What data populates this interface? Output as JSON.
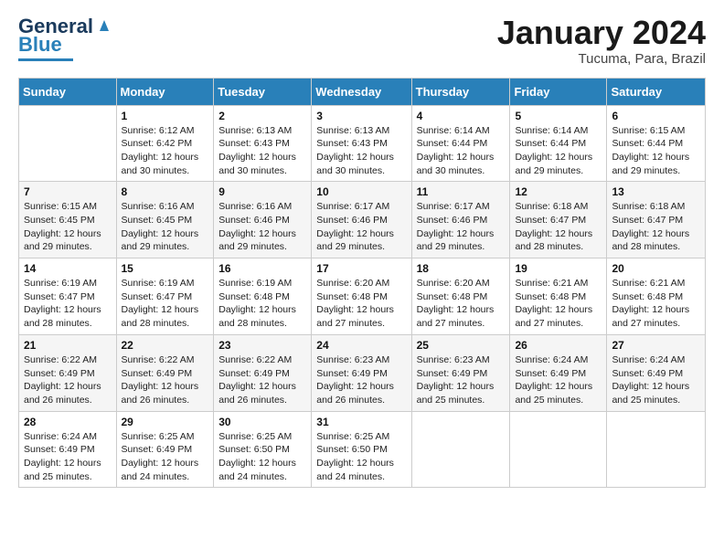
{
  "header": {
    "logo_general": "General",
    "logo_blue": "Blue",
    "month_title": "January 2024",
    "location": "Tucuma, Para, Brazil"
  },
  "days_of_week": [
    "Sunday",
    "Monday",
    "Tuesday",
    "Wednesday",
    "Thursday",
    "Friday",
    "Saturday"
  ],
  "weeks": [
    [
      {
        "day": "",
        "sunrise": "",
        "sunset": "",
        "daylight": ""
      },
      {
        "day": "1",
        "sunrise": "6:12 AM",
        "sunset": "6:42 PM",
        "daylight": "12 hours and 30 minutes."
      },
      {
        "day": "2",
        "sunrise": "6:13 AM",
        "sunset": "6:43 PM",
        "daylight": "12 hours and 30 minutes."
      },
      {
        "day": "3",
        "sunrise": "6:13 AM",
        "sunset": "6:43 PM",
        "daylight": "12 hours and 30 minutes."
      },
      {
        "day": "4",
        "sunrise": "6:14 AM",
        "sunset": "6:44 PM",
        "daylight": "12 hours and 30 minutes."
      },
      {
        "day": "5",
        "sunrise": "6:14 AM",
        "sunset": "6:44 PM",
        "daylight": "12 hours and 29 minutes."
      },
      {
        "day": "6",
        "sunrise": "6:15 AM",
        "sunset": "6:44 PM",
        "daylight": "12 hours and 29 minutes."
      }
    ],
    [
      {
        "day": "7",
        "sunrise": "6:15 AM",
        "sunset": "6:45 PM",
        "daylight": "12 hours and 29 minutes."
      },
      {
        "day": "8",
        "sunrise": "6:16 AM",
        "sunset": "6:45 PM",
        "daylight": "12 hours and 29 minutes."
      },
      {
        "day": "9",
        "sunrise": "6:16 AM",
        "sunset": "6:46 PM",
        "daylight": "12 hours and 29 minutes."
      },
      {
        "day": "10",
        "sunrise": "6:17 AM",
        "sunset": "6:46 PM",
        "daylight": "12 hours and 29 minutes."
      },
      {
        "day": "11",
        "sunrise": "6:17 AM",
        "sunset": "6:46 PM",
        "daylight": "12 hours and 29 minutes."
      },
      {
        "day": "12",
        "sunrise": "6:18 AM",
        "sunset": "6:47 PM",
        "daylight": "12 hours and 28 minutes."
      },
      {
        "day": "13",
        "sunrise": "6:18 AM",
        "sunset": "6:47 PM",
        "daylight": "12 hours and 28 minutes."
      }
    ],
    [
      {
        "day": "14",
        "sunrise": "6:19 AM",
        "sunset": "6:47 PM",
        "daylight": "12 hours and 28 minutes."
      },
      {
        "day": "15",
        "sunrise": "6:19 AM",
        "sunset": "6:47 PM",
        "daylight": "12 hours and 28 minutes."
      },
      {
        "day": "16",
        "sunrise": "6:19 AM",
        "sunset": "6:48 PM",
        "daylight": "12 hours and 28 minutes."
      },
      {
        "day": "17",
        "sunrise": "6:20 AM",
        "sunset": "6:48 PM",
        "daylight": "12 hours and 27 minutes."
      },
      {
        "day": "18",
        "sunrise": "6:20 AM",
        "sunset": "6:48 PM",
        "daylight": "12 hours and 27 minutes."
      },
      {
        "day": "19",
        "sunrise": "6:21 AM",
        "sunset": "6:48 PM",
        "daylight": "12 hours and 27 minutes."
      },
      {
        "day": "20",
        "sunrise": "6:21 AM",
        "sunset": "6:48 PM",
        "daylight": "12 hours and 27 minutes."
      }
    ],
    [
      {
        "day": "21",
        "sunrise": "6:22 AM",
        "sunset": "6:49 PM",
        "daylight": "12 hours and 26 minutes."
      },
      {
        "day": "22",
        "sunrise": "6:22 AM",
        "sunset": "6:49 PM",
        "daylight": "12 hours and 26 minutes."
      },
      {
        "day": "23",
        "sunrise": "6:22 AM",
        "sunset": "6:49 PM",
        "daylight": "12 hours and 26 minutes."
      },
      {
        "day": "24",
        "sunrise": "6:23 AM",
        "sunset": "6:49 PM",
        "daylight": "12 hours and 26 minutes."
      },
      {
        "day": "25",
        "sunrise": "6:23 AM",
        "sunset": "6:49 PM",
        "daylight": "12 hours and 25 minutes."
      },
      {
        "day": "26",
        "sunrise": "6:24 AM",
        "sunset": "6:49 PM",
        "daylight": "12 hours and 25 minutes."
      },
      {
        "day": "27",
        "sunrise": "6:24 AM",
        "sunset": "6:49 PM",
        "daylight": "12 hours and 25 minutes."
      }
    ],
    [
      {
        "day": "28",
        "sunrise": "6:24 AM",
        "sunset": "6:49 PM",
        "daylight": "12 hours and 25 minutes."
      },
      {
        "day": "29",
        "sunrise": "6:25 AM",
        "sunset": "6:49 PM",
        "daylight": "12 hours and 24 minutes."
      },
      {
        "day": "30",
        "sunrise": "6:25 AM",
        "sunset": "6:50 PM",
        "daylight": "12 hours and 24 minutes."
      },
      {
        "day": "31",
        "sunrise": "6:25 AM",
        "sunset": "6:50 PM",
        "daylight": "12 hours and 24 minutes."
      },
      {
        "day": "",
        "sunrise": "",
        "sunset": "",
        "daylight": ""
      },
      {
        "day": "",
        "sunrise": "",
        "sunset": "",
        "daylight": ""
      },
      {
        "day": "",
        "sunrise": "",
        "sunset": "",
        "daylight": ""
      }
    ]
  ],
  "labels": {
    "sunrise_prefix": "Sunrise: ",
    "sunset_prefix": "Sunset: ",
    "daylight_prefix": "Daylight: "
  }
}
